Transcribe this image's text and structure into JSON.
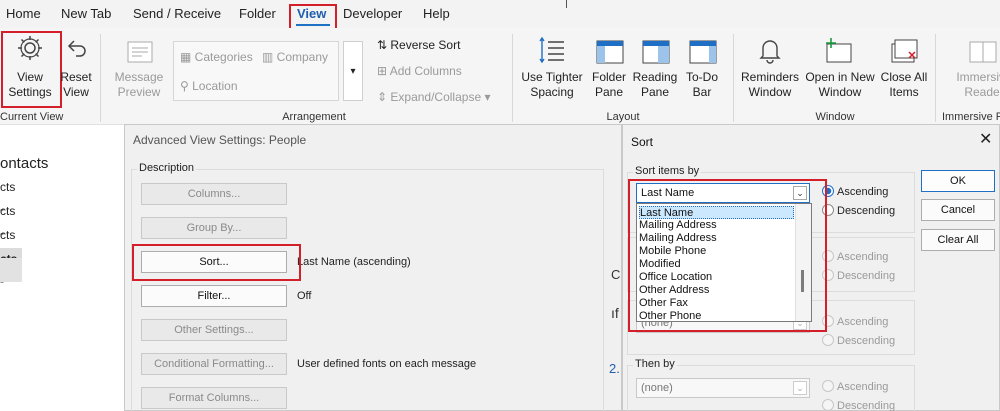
{
  "menu": {
    "items": [
      "Home",
      "New Tab",
      "Send / Receive",
      "Folder",
      "View",
      "Developer",
      "Help"
    ]
  },
  "ribbon": {
    "current_view": {
      "view_settings": "View Settings",
      "reset_view": "Reset View",
      "group": "Current View"
    },
    "arrangement": {
      "message_preview": "Message Preview",
      "categories": "Categories",
      "company": "Company",
      "location": "Location",
      "reverse_sort": "Reverse Sort",
      "add_columns": "Add Columns",
      "expand_collapse": "Expand/Collapse",
      "group": "Arrangement"
    },
    "layout": {
      "use_tighter_spacing": "Use Tighter Spacing",
      "folder_pane": "Folder Pane",
      "reading_pane": "Reading Pane",
      "todo_bar": "To-Do Bar",
      "group": "Layout"
    },
    "window": {
      "reminders_window": "Reminders Window",
      "open_new_window": "Open in New Window",
      "close_all_items": "Close All Items",
      "group": "Window"
    },
    "immersive": {
      "reader": "Immersive Reader",
      "group": "Immersive Re"
    }
  },
  "left_pane": {
    "title": "ontacts",
    "rows": [
      "cts -",
      "cts -",
      "cts -",
      "cts -"
    ]
  },
  "advanced_dialog": {
    "title": "Advanced View Settings: People",
    "description_label": "Description",
    "buttons": [
      {
        "label": "Columns...",
        "value": ""
      },
      {
        "label": "Group By...",
        "value": ""
      },
      {
        "label": "Sort...",
        "value": "Last Name (ascending)"
      },
      {
        "label": "Filter...",
        "value": "Off"
      },
      {
        "label": "Other Settings...",
        "value": ""
      },
      {
        "label": "Conditional Formatting...",
        "value": "User defined fonts on each message"
      },
      {
        "label": "Format Columns...",
        "value": ""
      }
    ]
  },
  "sort_dialog": {
    "title": "Sort",
    "sort_items_by": "Sort items by",
    "selected_field": "Last Name",
    "options": [
      "Last Name",
      "Mailing Address",
      "Mailing Address",
      "Mobile Phone",
      "Modified",
      "Office Location",
      "Other Address",
      "Other Fax",
      "Other Phone"
    ],
    "ascending": "Ascending",
    "descending": "Descending",
    "none_value": "(none)",
    "then_by": "Then by",
    "buttons": {
      "ok": "OK",
      "cancel": "Cancel",
      "clear_all": "Clear All"
    }
  },
  "background_fragments": {
    "tab_letter": "C",
    "dots": "ıf",
    "number": "2."
  }
}
